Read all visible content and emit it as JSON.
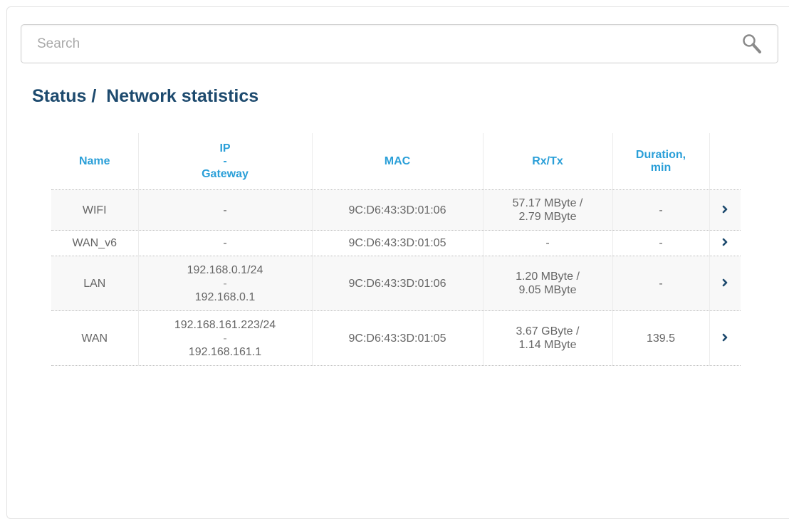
{
  "search": {
    "placeholder": "Search",
    "icon": "search-icon"
  },
  "page": {
    "breadcrumb_parent": "Status /",
    "breadcrumb_current": "Network statistics"
  },
  "table": {
    "headers": {
      "name": "Name",
      "ip_line1": "IP",
      "ip_line2": "-",
      "ip_line3": "Gateway",
      "mac": "MAC",
      "rxtx": "Rx/Tx",
      "duration_line1": "Duration,",
      "duration_line2": "min"
    },
    "rows": [
      {
        "name": "WIFI",
        "name_status": "up",
        "ip": "-",
        "mac": "9C:D6:43:3D:01:06",
        "rx": "57.17 MByte /",
        "tx": "2.79 MByte",
        "duration": "-"
      },
      {
        "name": "WAN_v6",
        "name_status": "down",
        "ip": "-",
        "mac": "9C:D6:43:3D:01:05",
        "rxtx": "-",
        "duration": "-"
      },
      {
        "name": "LAN",
        "name_status": "up",
        "ip": "192.168.0.1/24",
        "ip_sep": "-",
        "gateway": "192.168.0.1",
        "mac": "9C:D6:43:3D:01:06",
        "rx": "1.20 MByte /",
        "tx": "9.05 MByte",
        "duration": "-"
      },
      {
        "name": "WAN",
        "name_status": "up",
        "ip": "192.168.161.223/24",
        "ip_sep": "-",
        "gateway": "192.168.161.1",
        "mac": "9C:D6:43:3D:01:05",
        "rx": "3.67 GByte /",
        "tx": "1.14 MByte",
        "duration": "139.5"
      }
    ]
  },
  "colors": {
    "title": "#1d4a6e",
    "header": "#2a9fd8",
    "status_up": "#3a8a3a",
    "status_down": "#e0342c",
    "arrow": "#1d4a6e"
  }
}
